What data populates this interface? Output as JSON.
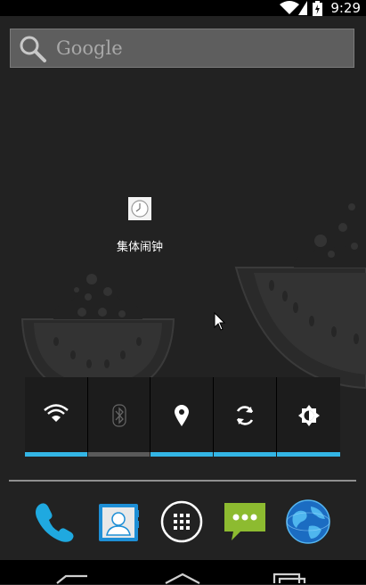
{
  "status_bar": {
    "time": "9:29",
    "icons": [
      "wifi-icon",
      "battery-charging-icon"
    ]
  },
  "search_widget": {
    "brand": "Google",
    "icon": "search-icon"
  },
  "desktop_shortcut": {
    "label": "集体闹钟",
    "icon": "clock-icon"
  },
  "power_control_widget": {
    "toggles": [
      {
        "name": "wifi",
        "icon": "wifi-icon",
        "enabled": true
      },
      {
        "name": "bluetooth",
        "icon": "bluetooth-icon",
        "enabled": false
      },
      {
        "name": "location",
        "icon": "location-icon",
        "enabled": true
      },
      {
        "name": "sync",
        "icon": "sync-icon",
        "enabled": true
      },
      {
        "name": "brightness",
        "icon": "brightness-icon",
        "enabled": true
      }
    ],
    "colors": {
      "on": "#33b5e5",
      "off": "#5a5a5a"
    }
  },
  "dock": {
    "apps": [
      "phone-icon",
      "contacts-icon",
      "all-apps-icon",
      "messaging-icon",
      "browser-icon"
    ]
  },
  "navigation_bar": {
    "buttons": [
      "back-icon",
      "home-icon",
      "recents-icon"
    ]
  }
}
